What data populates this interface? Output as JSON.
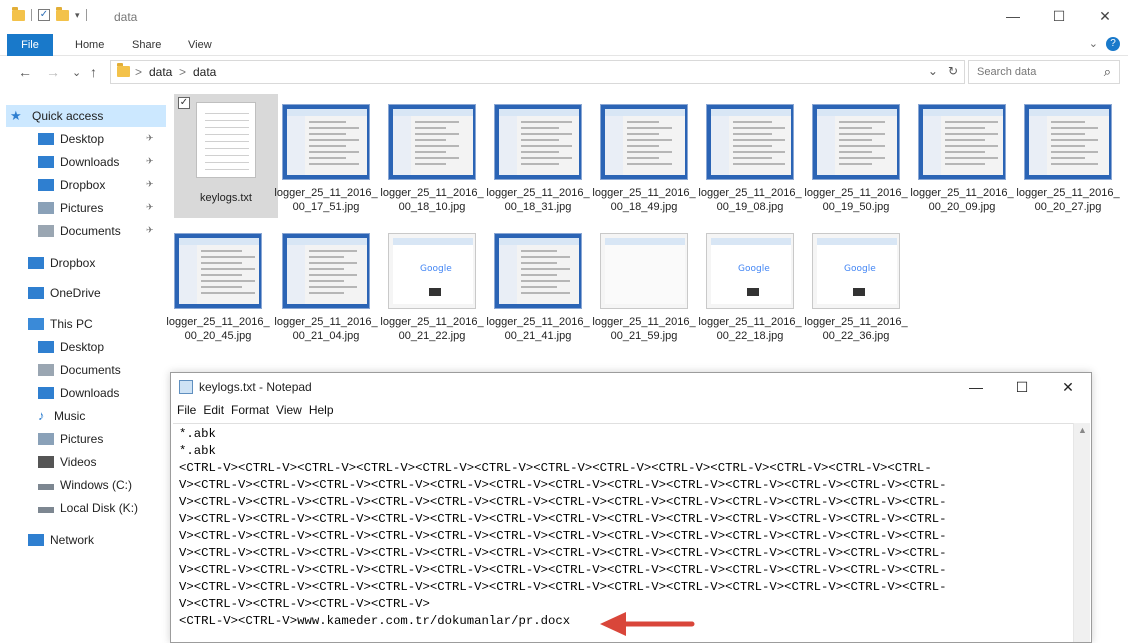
{
  "window": {
    "title": "data",
    "minimize": "—",
    "maximize": "☐",
    "close": "✕"
  },
  "ribbon": {
    "tabs": [
      "File",
      "Home",
      "Share",
      "View"
    ],
    "expand": "⌄",
    "help": "?"
  },
  "address": {
    "back": "←",
    "forward": "→",
    "recent": "⌄",
    "up": "↑",
    "crumbs": [
      "data",
      "data"
    ],
    "crumb_sep": ">",
    "dropdown": "⌄",
    "refresh": "↻"
  },
  "search": {
    "placeholder": "Search data",
    "icon": "⌕"
  },
  "nav": {
    "items": [
      {
        "label": "Quick access",
        "icon": "star-icon",
        "selected": true
      },
      {
        "label": "Desktop",
        "icon": "desktop-icon",
        "pinned": true
      },
      {
        "label": "Downloads",
        "icon": "download-icon",
        "pinned": true
      },
      {
        "label": "Dropbox",
        "icon": "dropbox-icon",
        "pinned": true
      },
      {
        "label": "Pictures",
        "icon": "pictures-icon",
        "pinned": true
      },
      {
        "label": "Documents",
        "icon": "documents-icon",
        "pinned": true
      },
      {
        "label": "Dropbox",
        "icon": "dropbox-icon"
      },
      {
        "label": "OneDrive",
        "icon": "cloud-icon"
      },
      {
        "label": "This PC",
        "icon": "computer-icon"
      },
      {
        "label": "Desktop",
        "icon": "desktop-icon"
      },
      {
        "label": "Documents",
        "icon": "documents-icon"
      },
      {
        "label": "Downloads",
        "icon": "download-icon"
      },
      {
        "label": "Music",
        "icon": "music-icon"
      },
      {
        "label": "Pictures",
        "icon": "pictures-icon"
      },
      {
        "label": "Videos",
        "icon": "videos-icon"
      },
      {
        "label": "Windows (C:)",
        "icon": "drive-icon"
      },
      {
        "label": "Local Disk (K:)",
        "icon": "drive-icon"
      },
      {
        "label": "Network",
        "icon": "network-icon"
      }
    ],
    "pin_glyph": "✈"
  },
  "files": [
    {
      "name": "keylogs.txt",
      "kind": "text",
      "selected": true
    },
    {
      "name": "logger_25_11_2016_00_17_51.jpg",
      "kind": "screen"
    },
    {
      "name": "logger_25_11_2016_00_18_10.jpg",
      "kind": "screen"
    },
    {
      "name": "logger_25_11_2016_00_18_31.jpg",
      "kind": "screen"
    },
    {
      "name": "logger_25_11_2016_00_18_49.jpg",
      "kind": "screen"
    },
    {
      "name": "logger_25_11_2016_00_19_08.jpg",
      "kind": "screen"
    },
    {
      "name": "logger_25_11_2016_00_19_50.jpg",
      "kind": "screen"
    },
    {
      "name": "logger_25_11_2016_00_20_09.jpg",
      "kind": "screen"
    },
    {
      "name": "logger_25_11_2016_00_20_27.jpg",
      "kind": "screen"
    },
    {
      "name": "logger_25_11_2016_00_20_45.jpg",
      "kind": "screen"
    },
    {
      "name": "logger_25_11_2016_00_21_04.jpg",
      "kind": "screen"
    },
    {
      "name": "logger_25_11_2016_00_21_22.jpg",
      "kind": "google"
    },
    {
      "name": "logger_25_11_2016_00_21_41.jpg",
      "kind": "screen"
    },
    {
      "name": "logger_25_11_2016_00_21_59.jpg",
      "kind": "blank"
    },
    {
      "name": "logger_25_11_2016_00_22_18.jpg",
      "kind": "google"
    },
    {
      "name": "logger_25_11_2016_00_22_36.jpg",
      "kind": "google"
    }
  ],
  "google_text": "Google",
  "notepad": {
    "title": "keylogs.txt - Notepad",
    "minimize": "—",
    "maximize": "☐",
    "close": "✕",
    "menu": [
      "File",
      "Edit",
      "Format",
      "View",
      "Help"
    ],
    "lines": [
      "*.abk",
      "*.abk",
      "<CTRL-V><CTRL-V><CTRL-V><CTRL-V><CTRL-V><CTRL-V><CTRL-V><CTRL-V><CTRL-V><CTRL-V><CTRL-V><CTRL-V><CTRL-",
      "V><CTRL-V><CTRL-V><CTRL-V><CTRL-V><CTRL-V><CTRL-V><CTRL-V><CTRL-V><CTRL-V><CTRL-V><CTRL-V><CTRL-V><CTRL-",
      "V><CTRL-V><CTRL-V><CTRL-V><CTRL-V><CTRL-V><CTRL-V><CTRL-V><CTRL-V><CTRL-V><CTRL-V><CTRL-V><CTRL-V><CTRL-",
      "V><CTRL-V><CTRL-V><CTRL-V><CTRL-V><CTRL-V><CTRL-V><CTRL-V><CTRL-V><CTRL-V><CTRL-V><CTRL-V><CTRL-V><CTRL-",
      "V><CTRL-V><CTRL-V><CTRL-V><CTRL-V><CTRL-V><CTRL-V><CTRL-V><CTRL-V><CTRL-V><CTRL-V><CTRL-V><CTRL-V><CTRL-",
      "V><CTRL-V><CTRL-V><CTRL-V><CTRL-V><CTRL-V><CTRL-V><CTRL-V><CTRL-V><CTRL-V><CTRL-V><CTRL-V><CTRL-V><CTRL-",
      "V><CTRL-V><CTRL-V><CTRL-V><CTRL-V><CTRL-V><CTRL-V><CTRL-V><CTRL-V><CTRL-V><CTRL-V><CTRL-V><CTRL-V><CTRL-",
      "V><CTRL-V><CTRL-V><CTRL-V><CTRL-V><CTRL-V><CTRL-V><CTRL-V><CTRL-V><CTRL-V><CTRL-V><CTRL-V><CTRL-V><CTRL-",
      "V><CTRL-V><CTRL-V><CTRL-V><CTRL-V>",
      "<CTRL-V><CTRL-V>www.kameder.com.tr/dokumanlar/pr.docx"
    ]
  },
  "colors": {
    "accent": "#1979ca",
    "selection": "#cce8ff",
    "annotation_arrow": "#d9463a"
  }
}
